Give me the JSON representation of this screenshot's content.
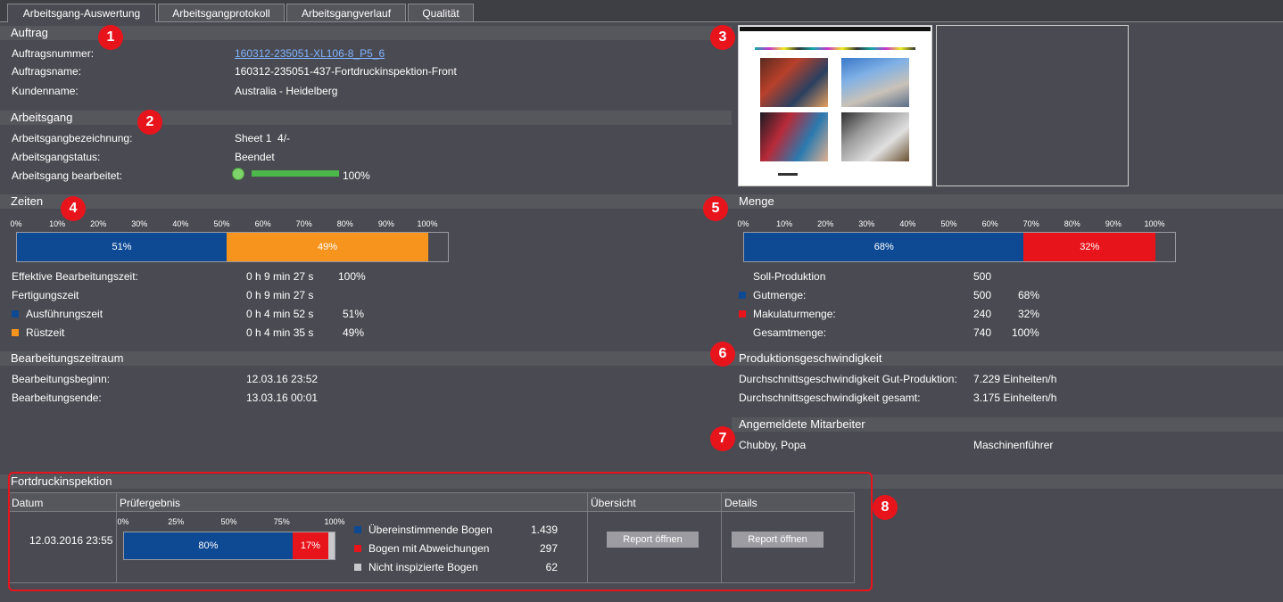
{
  "tabs": [
    "Arbeitsgang-Auswertung",
    "Arbeitsgangprotokoll",
    "Arbeitsgangverlauf",
    "Qualität"
  ],
  "auftrag": {
    "title": "Auftrag",
    "nummer_label": "Auftragsnummer:",
    "nummer_value": "160312-235051-XL106-8_P5_6",
    "name_label": "Auftragsname:",
    "name_value": "160312-235051-437-Fortdruckinspektion-Front",
    "kunde_label": "Kundenname:",
    "kunde_value": "Australia - Heidelberg"
  },
  "arbeitsgang": {
    "title": "Arbeitsgang",
    "bez_label": "Arbeitsgangbezeichnung:",
    "bez_value": "Sheet 1  4/-",
    "status_label": "Arbeitsgangstatus:",
    "status_value": "Beendet",
    "bearb_label": "Arbeitsgang bearbeitet:",
    "bearb_progress": 1.0,
    "bearb_value": "100%"
  },
  "zeiten": {
    "title": "Zeiten",
    "scale": [
      "0%",
      "10%",
      "20%",
      "30%",
      "40%",
      "50%",
      "60%",
      "70%",
      "80%",
      "90%",
      "100%"
    ],
    "bar": [
      {
        "value": 51,
        "label": "51%",
        "color": "#0e4a94"
      },
      {
        "value": 49,
        "label": "49%",
        "color": "#f7941d"
      }
    ],
    "rows": [
      {
        "label": "Effektive Bearbeitungszeit:",
        "value": "0 h 9 min 27 s",
        "pct": "100%"
      },
      {
        "label": "Fertigungszeit",
        "value": "0 h 9 min 27 s",
        "pct": ""
      },
      {
        "label": "Ausführungszeit",
        "value": "0 h 4 min 52 s",
        "pct": "51%",
        "color": "#0e4a94"
      },
      {
        "label": "Rüstzeit",
        "value": "0 h 4 min 35 s",
        "pct": "49%",
        "color": "#f7941d"
      }
    ]
  },
  "zeitraum": {
    "title": "Bearbeitungszeitraum",
    "beginn_label": "Bearbeitungsbeginn:",
    "beginn_value": "12.03.16 23:52",
    "ende_label": "Bearbeitungsende:",
    "ende_value": "13.03.16 00:01"
  },
  "menge": {
    "title": "Menge",
    "scale": [
      "0%",
      "10%",
      "20%",
      "30%",
      "40%",
      "50%",
      "60%",
      "70%",
      "80%",
      "90%",
      "100%"
    ],
    "bar": [
      {
        "value": 68,
        "label": "68%",
        "color": "#0e4a94"
      },
      {
        "value": 32,
        "label": "32%",
        "color": "#e8141c"
      }
    ],
    "rows": [
      {
        "label": "Soll-Produktion",
        "value": "500",
        "pct": ""
      },
      {
        "label": "Gutmenge:",
        "value": "500",
        "pct": "68%",
        "color": "#0e4a94"
      },
      {
        "label": "Makulaturmenge:",
        "value": "240",
        "pct": "32%",
        "color": "#e8141c"
      },
      {
        "label": "Gesamtmenge:",
        "value": "740",
        "pct": "100%"
      }
    ]
  },
  "speed": {
    "title": "Produktionsgeschwindigkeit",
    "gut_label": "Durchschnittsgeschwindigkeit Gut-Produktion:",
    "gut_value": "7.229 Einheiten/h",
    "ges_label": "Durchschnittsgeschwindigkeit gesamt:",
    "ges_value": "3.175 Einheiten/h"
  },
  "mitarbeiter": {
    "title": "Angemeldete Mitarbeiter",
    "name": "Chubby, Popa",
    "role": "Maschinenführer"
  },
  "fortdruck": {
    "title": "Fortdruckinspektion",
    "col_datum": "Datum",
    "col_pruef": "Prüfergebnis",
    "col_uebersicht": "Übersicht",
    "col_details": "Details",
    "datum": "12.03.2016 23:55",
    "scale": [
      "0%",
      "25%",
      "50%",
      "75%",
      "100%"
    ],
    "bar": [
      {
        "value": 80,
        "label": "80%",
        "color": "#0e4a94"
      },
      {
        "value": 17,
        "label": "17%",
        "color": "#e8141c"
      },
      {
        "value": 3,
        "label": "",
        "color": "#c8c8cc"
      }
    ],
    "legend": [
      {
        "label": "Übereinstimmende Bogen",
        "value": "1.439",
        "color": "#0e4a94"
      },
      {
        "label": "Bogen mit Abweichungen",
        "value": "297",
        "color": "#e8141c"
      },
      {
        "label": "Nicht inspizierte Bogen",
        "value": "62",
        "color": "#c8c8cc"
      }
    ],
    "report_btn": "Report öffnen"
  },
  "badges": [
    "1",
    "2",
    "3",
    "4",
    "5",
    "6",
    "7",
    "8"
  ]
}
